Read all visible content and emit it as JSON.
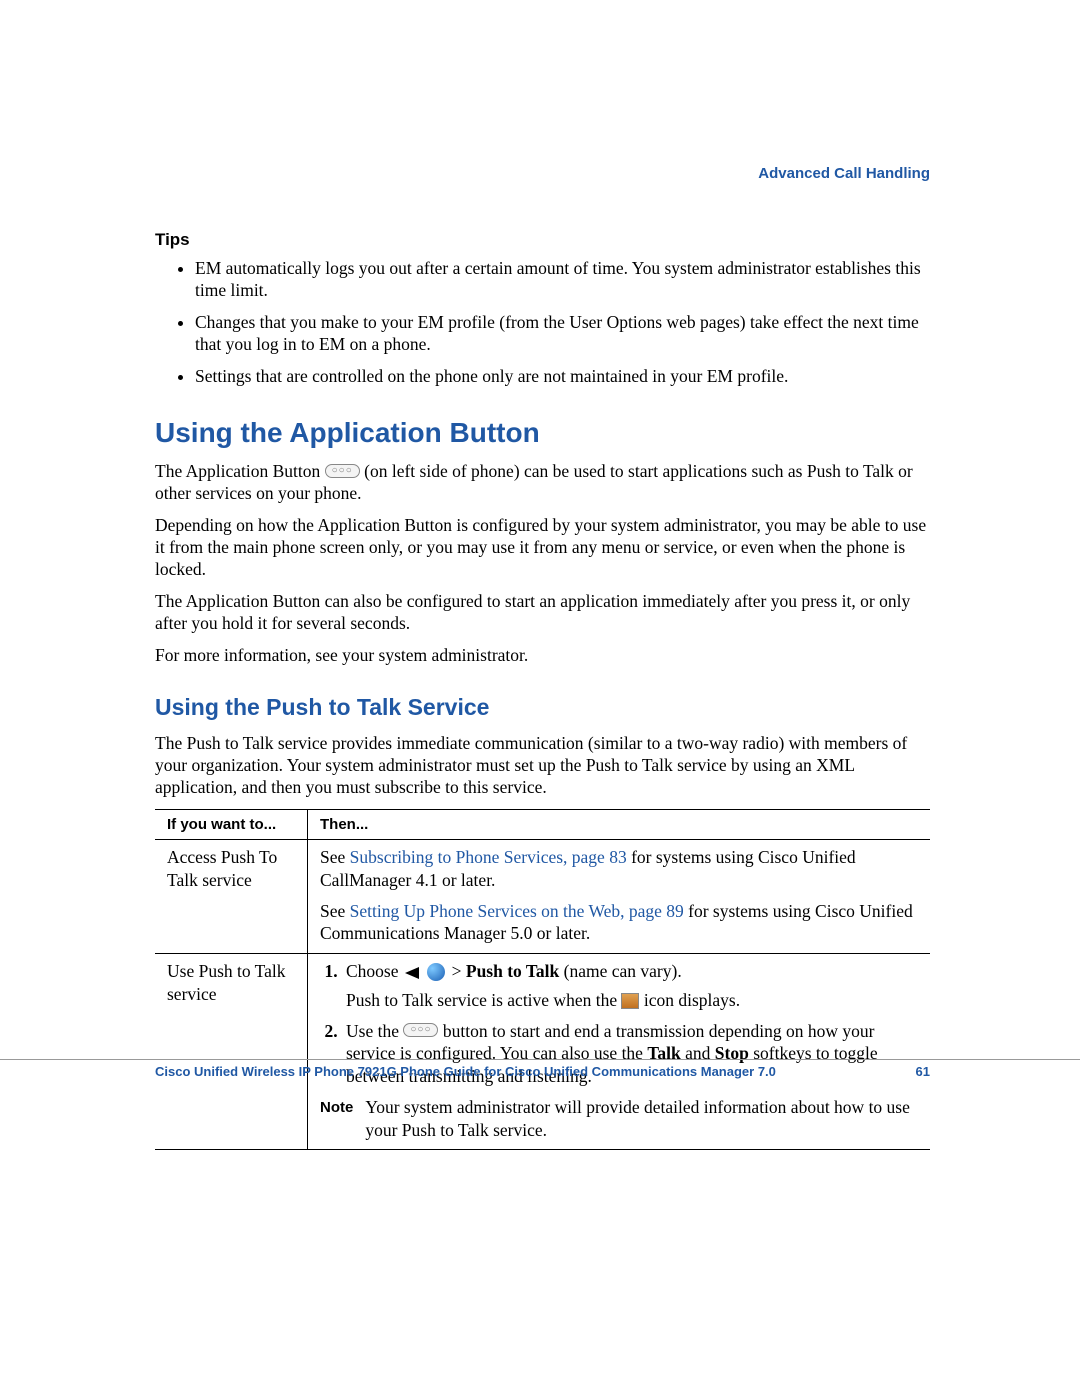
{
  "header": {
    "section": "Advanced Call Handling"
  },
  "tips": {
    "heading": "Tips",
    "items": [
      "EM automatically logs you out after a certain amount of time. You system administrator establishes this time limit.",
      "Changes that you make to your EM profile (from the User Options web pages) take effect the next time that you log in to EM on a phone.",
      "Settings that are controlled on the phone only are not maintained in your EM profile."
    ]
  },
  "section1": {
    "title": "Using the Application Button",
    "p1a": "The Application Button ",
    "p1b": " (on left side of phone) can be used to start applications such as Push to Talk or other services on your phone.",
    "p2": "Depending on how the Application Button is configured by your system administrator, you may be able to use it from the main phone screen only, or you may use it from any menu or service, or even when the phone is locked.",
    "p3": "The Application Button can also be configured to start an application immediately after you press it, or only after you hold it for several seconds.",
    "p4": "For more information, see your system administrator."
  },
  "section2": {
    "title": "Using the Push to Talk Service",
    "intro": "The Push to Talk service provides immediate communication (similar to a two-way radio) with members of your organization. Your system administrator must set up the Push to Talk service by using an XML application, and then you must subscribe to this service."
  },
  "table": {
    "col1": "If you want to...",
    "col2": "Then...",
    "row1": {
      "left": "Access Push To Talk service",
      "r1a": "See ",
      "r1link": "Subscribing to Phone Services, page 83",
      "r1b": " for systems using Cisco Unified CallManager 4.1 or later.",
      "r2a": "See ",
      "r2link": "Setting Up Phone Services on the Web, page 89",
      "r2b": " for systems using Cisco Unified Communications Manager 5.0 or later."
    },
    "row2": {
      "left": "Use Push to Talk service",
      "s1a": "Choose ",
      "s1b": " > ",
      "s1bold": "Push to Talk",
      "s1c": " (name can vary).",
      "s1line2a": "Push to Talk service is active when the ",
      "s1line2b": " icon displays.",
      "s2a": "Use the ",
      "s2b": " button to start and end a transmission depending on how your service is configured. You can also use the ",
      "s2talk": "Talk",
      "s2mid": " and ",
      "s2stop": "Stop",
      "s2c": " softkeys to toggle between transmitting and listening.",
      "noteLabel": "Note",
      "noteText": "Your system administrator will provide detailed information about how to use your Push to Talk service."
    }
  },
  "icons": {
    "appButtonGlyph": "○○○"
  },
  "footer": {
    "title": "Cisco Unified Wireless IP Phone 7921G Phone Guide for Cisco Unified Communications Manager 7.0",
    "page": "61"
  }
}
